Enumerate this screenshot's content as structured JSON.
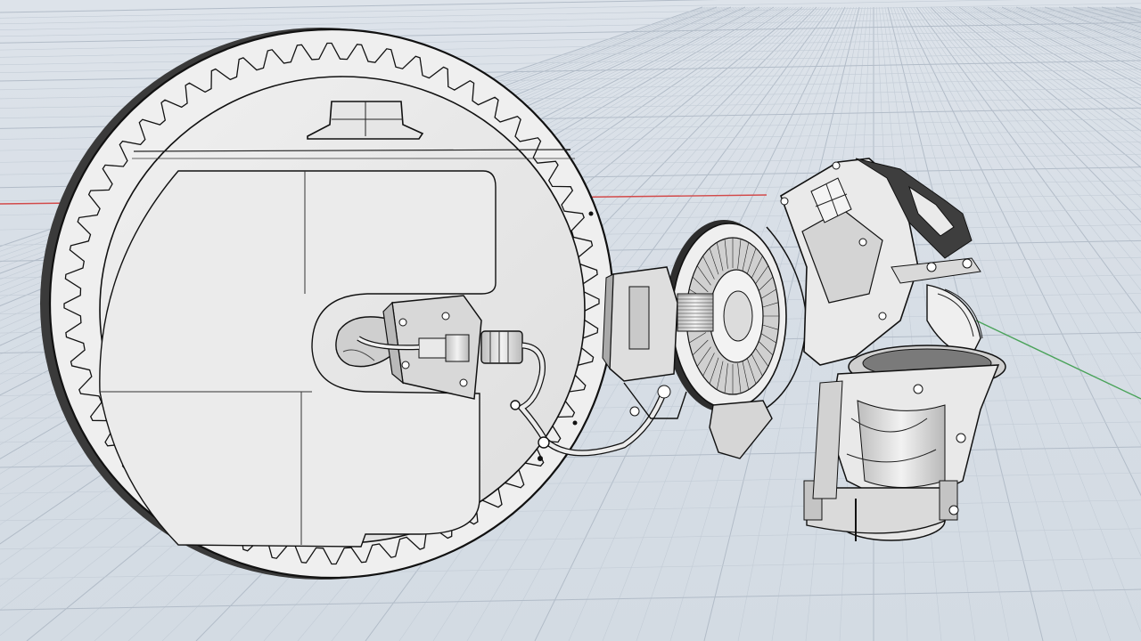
{
  "viewport": {
    "view": "perspective",
    "display_mode": "technical",
    "colors": {
      "background": "#d9e0e7",
      "grid_minor": "#c3ccd6",
      "grid_major": "#b2bcc8",
      "x_axis": "#d24a4a",
      "y_axis": "#4aa35a",
      "model_fill": "#ececec",
      "model_shade": "#cfcfcf",
      "edge": "#111111"
    }
  },
  "model": {
    "parts": [
      {
        "name": "toothed-disc",
        "icon": "gear-disc-icon"
      },
      {
        "name": "mounting-bracket",
        "icon": "bracket-icon"
      },
      {
        "name": "cable-harness",
        "icon": "cable-icon"
      },
      {
        "name": "bearing-ring",
        "icon": "bearing-icon"
      },
      {
        "name": "motor-housing",
        "icon": "motor-icon"
      },
      {
        "name": "gearbox",
        "icon": "gearbox-icon"
      }
    ]
  }
}
